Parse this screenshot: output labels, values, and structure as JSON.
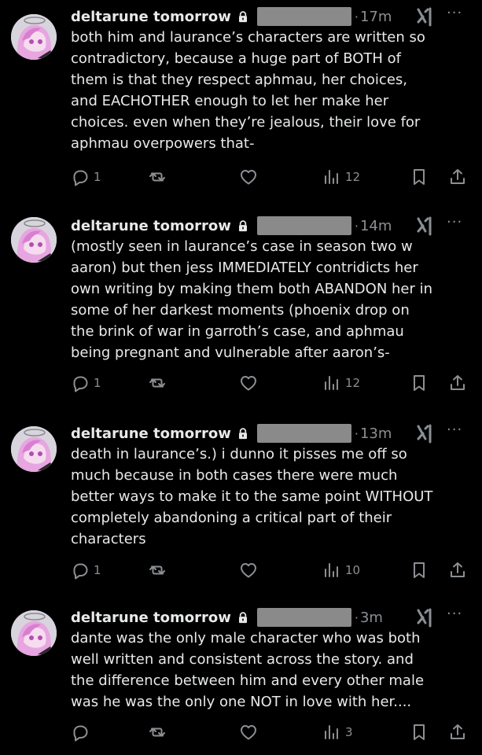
{
  "posts": [
    {
      "author": "deltarune tomorrow",
      "time": "17m",
      "text": "both him and laurance’s characters are written so\ncontradictory, because a huge part of BOTH of\nthem is that they respect aphmau, her choices,\nand EACHOTHER enough to let her make her\nchoices. even when they’re jealous, their love for\naphmau overpowers that-",
      "replies": "1",
      "views": "12"
    },
    {
      "author": "deltarune tomorrow",
      "time": "14m",
      "text": "(mostly seen in laurance’s case in season two w\naaron) but then jess IMMEDIATELY contridicts her\nown writing by making them both ABANDON her in\nsome of her darkest moments (phoenix drop on\nthe brink of war in garroth’s case, and aphmau\nbeing pregnant and vulnerable after aaron’s-",
      "replies": "1",
      "views": "12"
    },
    {
      "author": "deltarune tomorrow",
      "time": "13m",
      "text": "death in laurance’s.) i dunno it pisses me off so\nmuch because in both cases there were much\nbetter ways to make it to the same point WITHOUT\ncompletely abandoning a critical part of their\ncharacters",
      "replies": "1",
      "views": "10"
    },
    {
      "author": "deltarune tomorrow",
      "time": "3m",
      "text": "dante was the only male character who was both\nwell written and consistent across the story. and\nthe difference between him and every other male\nwas he was the only one NOT in love with her....",
      "replies": "",
      "views": "3"
    }
  ],
  "dot": "·",
  "more": "···",
  "icons": {
    "reply": "reply-icon",
    "repost": "repost-icon",
    "like": "heart-icon",
    "views": "views-icon",
    "bookmark": "bookmark-icon",
    "share": "share-icon",
    "lock": "lock-icon",
    "grok": "grok-icon"
  },
  "colors": {
    "background": "#000000",
    "text": "#e7e9ea",
    "muted": "#8b8f94",
    "redaction": "#8a8a8a"
  }
}
